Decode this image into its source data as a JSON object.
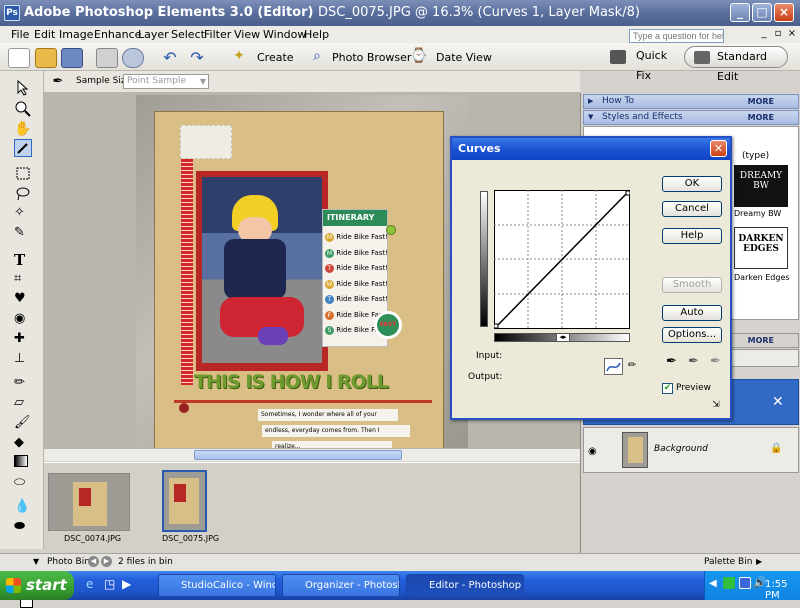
{
  "window": {
    "app_name": "Adobe Photoshop Elements 3.0 (Editor)",
    "doc_info": "DSC_0075.JPG @ 16.3% (Curves 1, Layer Mask/8)"
  },
  "menu": [
    "File",
    "Edit",
    "Image",
    "Enhance",
    "Layer",
    "Select",
    "Filter",
    "View",
    "Window",
    "Help"
  ],
  "help_search_placeholder": "Type a question for help",
  "shortcuts": {
    "create": "Create",
    "photo_browser": "Photo Browser",
    "date_view": "Date View",
    "quick_fix": "Quick Fix",
    "standard_edit": "Standard Edit"
  },
  "options_bar": {
    "sample_size_label": "Sample Size:",
    "sample_size_value": "Point Sample"
  },
  "scrapbook": {
    "itinerary_title": "ITINERARY",
    "lines": [
      "Ride Bike Fast!",
      "Ride Bike Fast!",
      "Ride Bike Fast!",
      "Ride Bike Fast!",
      "Ride Bike Fast!",
      "Ride Bike Fast!",
      "Ride Bike Fast!"
    ],
    "letters": [
      "M",
      "T",
      "W",
      "T",
      "F",
      "S",
      "S"
    ],
    "headline": "THIS IS HOW I ROLL",
    "journal": [
      "Sometimes, I wonder where all of your",
      "endless, everyday comes from. Then I",
      "realize..."
    ],
    "tag": "FAST"
  },
  "photo_bin": {
    "thumbs": [
      "DSC_0074.JPG",
      "DSC_0075.JPG"
    ],
    "label": "Photo Bin",
    "count": "2 files in bin",
    "palette_bin": "Palette Bin"
  },
  "palette": {
    "how_to": "How To",
    "styles": "Styles and Effects",
    "more": "MORE",
    "style_items": [
      "(type)",
      "DREAMY BW",
      "Dreamy BW",
      "DARKEN EDGES",
      "Darken Edges"
    ],
    "background_layer": "Background"
  },
  "curves": {
    "title": "Curves",
    "buttons": {
      "ok": "OK",
      "cancel": "Cancel",
      "help": "Help",
      "smooth": "Smooth",
      "auto": "Auto",
      "options": "Options..."
    },
    "input_label": "Input:",
    "output_label": "Output:",
    "preview_label": "Preview",
    "preview_checked": true
  },
  "taskbar": {
    "start": "start",
    "tasks": [
      "StudioCalico - Windo...",
      "Organizer - Photosho...",
      "Editor - Photoshop El..."
    ],
    "clock": "1:55 PM"
  }
}
